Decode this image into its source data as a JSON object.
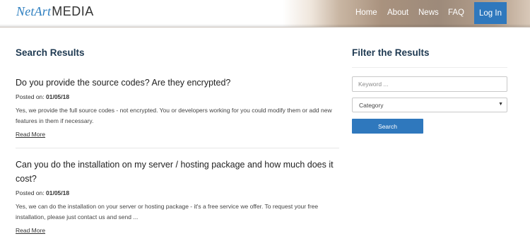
{
  "header": {
    "logo_netart": "NetArt",
    "logo_media": "MEDIA",
    "nav": {
      "home": "Home",
      "about": "About",
      "news": "News",
      "faq": "FAQ",
      "login": "Log In"
    }
  },
  "main": {
    "title": "Search Results",
    "results": [
      {
        "title": "Do you provide the source codes? Are they encrypted?",
        "posted_label": "Posted on:",
        "posted_date": "01/05/18",
        "excerpt": "Yes, we provide the full source codes - not encrypted. You or developers working for you could modify them or add new features in them if necessary.",
        "read_more": "Read More"
      },
      {
        "title": "Can you do the installation on my server / hosting package and how much does it cost?",
        "posted_label": "Posted on:",
        "posted_date": "01/05/18",
        "excerpt": "Yes, we can do the installation on your server or hosting package - it's a free service we offer. To request your free installation, please just contact us and send ...",
        "read_more": "Read More"
      }
    ]
  },
  "sidebar": {
    "title": "Filter the Results",
    "keyword_placeholder": "Keyword ...",
    "keyword_value": "",
    "category_selected": "Category",
    "search_label": "Search"
  },
  "colors": {
    "brand_blue": "#2f78bd",
    "heading": "#1f3a52"
  },
  "icons": {
    "select_arrow": "chevron-down-icon"
  }
}
